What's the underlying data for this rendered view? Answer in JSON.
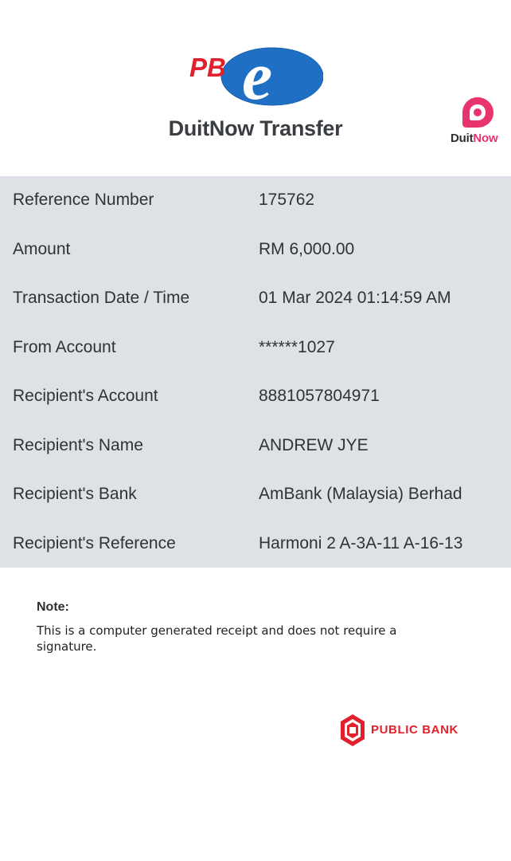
{
  "header": {
    "brand_logo": "PBe",
    "title": "DuitNow Transfer",
    "duitnow_logo": {
      "word_dark": "Duit",
      "word_pink": "Now"
    }
  },
  "details": [
    {
      "label": "Reference Number",
      "value": "175762"
    },
    {
      "label": "Amount",
      "value": "RM 6,000.00"
    },
    {
      "label": "Transaction Date / Time",
      "value": "01 Mar 2024 01:14:59 AM"
    },
    {
      "label": "From Account",
      "value": "******1027"
    },
    {
      "label": "Recipient's Account",
      "value": "8881057804971"
    },
    {
      "label": "Recipient's Name",
      "value": "ANDREW JYE"
    },
    {
      "label": "Recipient's Bank",
      "value": "AmBank (Malaysia) Berhad"
    },
    {
      "label": "Recipient's Reference",
      "value": "Harmoni 2 A-3A-11 A-16-13"
    }
  ],
  "note": {
    "title": "Note:",
    "text": "This is a computer generated receipt and does not require a signature."
  },
  "footer": {
    "bank_name": "PUBLIC BANK"
  },
  "colors": {
    "pb_red": "#e0202b",
    "pbe_blue": "#1f6fc4",
    "duitnow_pink": "#e8336d",
    "table_bg": "#dee2e7"
  },
  "icons": [
    "pbe-logo-icon",
    "duitnow-logo-icon",
    "public-bank-logo-icon"
  ]
}
